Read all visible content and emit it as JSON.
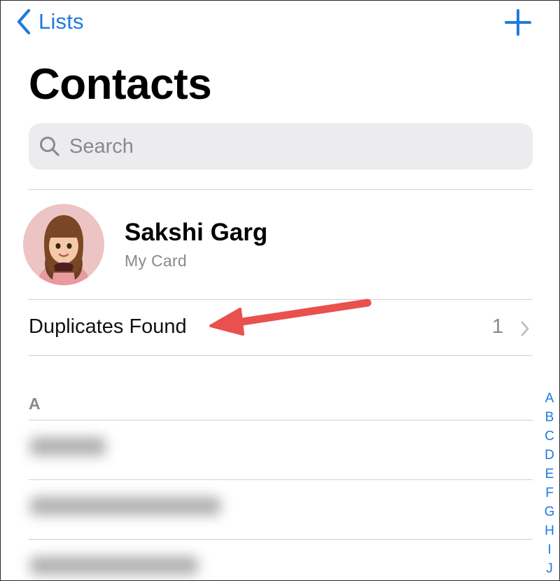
{
  "nav": {
    "back_label": "Lists"
  },
  "title": "Contacts",
  "search": {
    "placeholder": "Search"
  },
  "my_card": {
    "name": "Sakshi Garg",
    "subtitle": "My Card"
  },
  "duplicates": {
    "label": "Duplicates Found",
    "count": "1"
  },
  "section": {
    "letter": "A"
  },
  "index_letters": [
    "A",
    "B",
    "C",
    "D",
    "E",
    "F",
    "G",
    "H",
    "I",
    "J"
  ],
  "colors": {
    "accent": "#1f7ae0",
    "annotation_arrow": "#e9514e",
    "search_bg": "#ececee"
  },
  "icons": {
    "back": "chevron-left-icon",
    "add": "plus-icon",
    "search": "magnifier-icon",
    "row": "chevron-right-icon"
  }
}
